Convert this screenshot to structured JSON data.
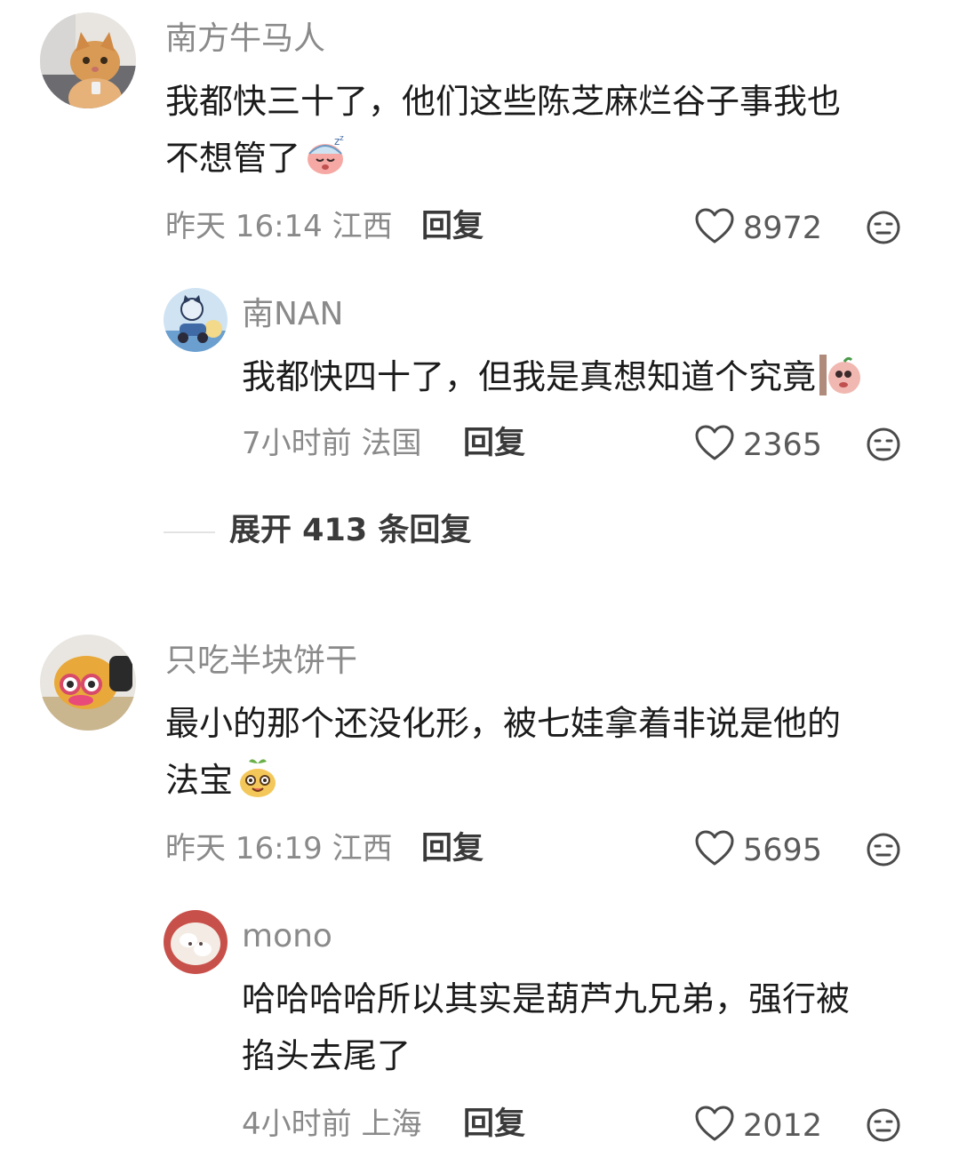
{
  "comments": [
    {
      "username": "南方牛马人",
      "text_line1": "我都快三十了，他们这些陈芝麻烂谷子事我也",
      "text_line2": "不想管了",
      "time": "昨天 16:14",
      "location": "江西",
      "reply_label": "回复",
      "likes": "8972",
      "avatar_icon": "cat-avatar",
      "emoji_icon": "sleepy-face-emoji"
    },
    {
      "username": "南NAN",
      "text_line1": "我都快四十了，但我是真想知道个究竟",
      "time": "7小时前",
      "location": "法国",
      "reply_label": "回复",
      "likes": "2365",
      "avatar_icon": "cartoon-scooter-avatar",
      "emoji_icon": "peeking-face-emoji"
    },
    {
      "username": "只吃半块饼干",
      "text_line1": "最小的那个还没化形，被七娃拿着非说是他的",
      "text_line2": "法宝",
      "time": "昨天 16:19",
      "location": "江西",
      "reply_label": "回复",
      "likes": "5695",
      "avatar_icon": "plush-toy-avatar",
      "emoji_icon": "happy-sprout-face-emoji"
    },
    {
      "username": "mono",
      "text_line1": "哈哈哈哈所以其实是葫芦九兄弟，强行被",
      "text_line2": "掐头去尾了",
      "time": "4小时前",
      "location": "上海",
      "reply_label": "回复",
      "likes": "2012",
      "avatar_icon": "fluffy-white-avatar"
    }
  ],
  "expand_replies": "展开 413 条回复",
  "colors": {
    "meta_gray": "#8a8a8a",
    "text": "#1b1b1b",
    "bold_gray": "#3a3a3a"
  },
  "icons": {
    "like": "heart-outline-icon",
    "dislike": "meh-face-icon"
  }
}
